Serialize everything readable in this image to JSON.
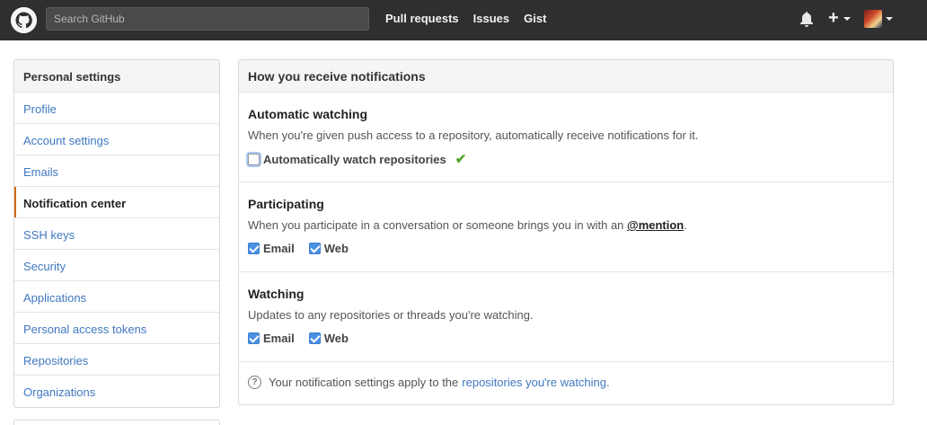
{
  "header": {
    "search_placeholder": "Search GitHub",
    "nav": [
      "Pull requests",
      "Issues",
      "Gist"
    ],
    "plus_glyph": "+",
    "background": "#2f2f2f"
  },
  "sidebar": {
    "title": "Personal settings",
    "items": [
      {
        "label": "Profile"
      },
      {
        "label": "Account settings"
      },
      {
        "label": "Emails"
      },
      {
        "label": "Notification center",
        "active": true
      },
      {
        "label": "SSH keys"
      },
      {
        "label": "Security"
      },
      {
        "label": "Applications"
      },
      {
        "label": "Personal access tokens"
      },
      {
        "label": "Repositories"
      },
      {
        "label": "Organizations"
      }
    ],
    "active_accent": "#d26911"
  },
  "panel": {
    "title": "How you receive notifications",
    "sections": [
      {
        "title": "Automatic watching",
        "desc": "When you're given push access to a repository, automatically receive notifications for it.",
        "options": [
          {
            "label": "Automatically watch repositories",
            "checked": false
          }
        ],
        "saved_icon": "check-icon"
      },
      {
        "title": "Participating",
        "desc_before": "When you participate in a conversation or someone brings you in with an ",
        "mention": "@mention",
        "desc_after": ".",
        "options": [
          {
            "label": "Email",
            "checked": true
          },
          {
            "label": "Web",
            "checked": true
          }
        ]
      },
      {
        "title": "Watching",
        "desc": "Updates to any repositories or threads you're watching.",
        "options": [
          {
            "label": "Email",
            "checked": true
          },
          {
            "label": "Web",
            "checked": true
          }
        ]
      }
    ],
    "footer": {
      "icon": "question-icon",
      "text": "Your notification settings apply to the",
      "link": "repositories you're watching",
      "after": "."
    }
  },
  "colors": {
    "link": "#4078c0",
    "checkbox": "#4a90e2",
    "success": "#55a532"
  }
}
